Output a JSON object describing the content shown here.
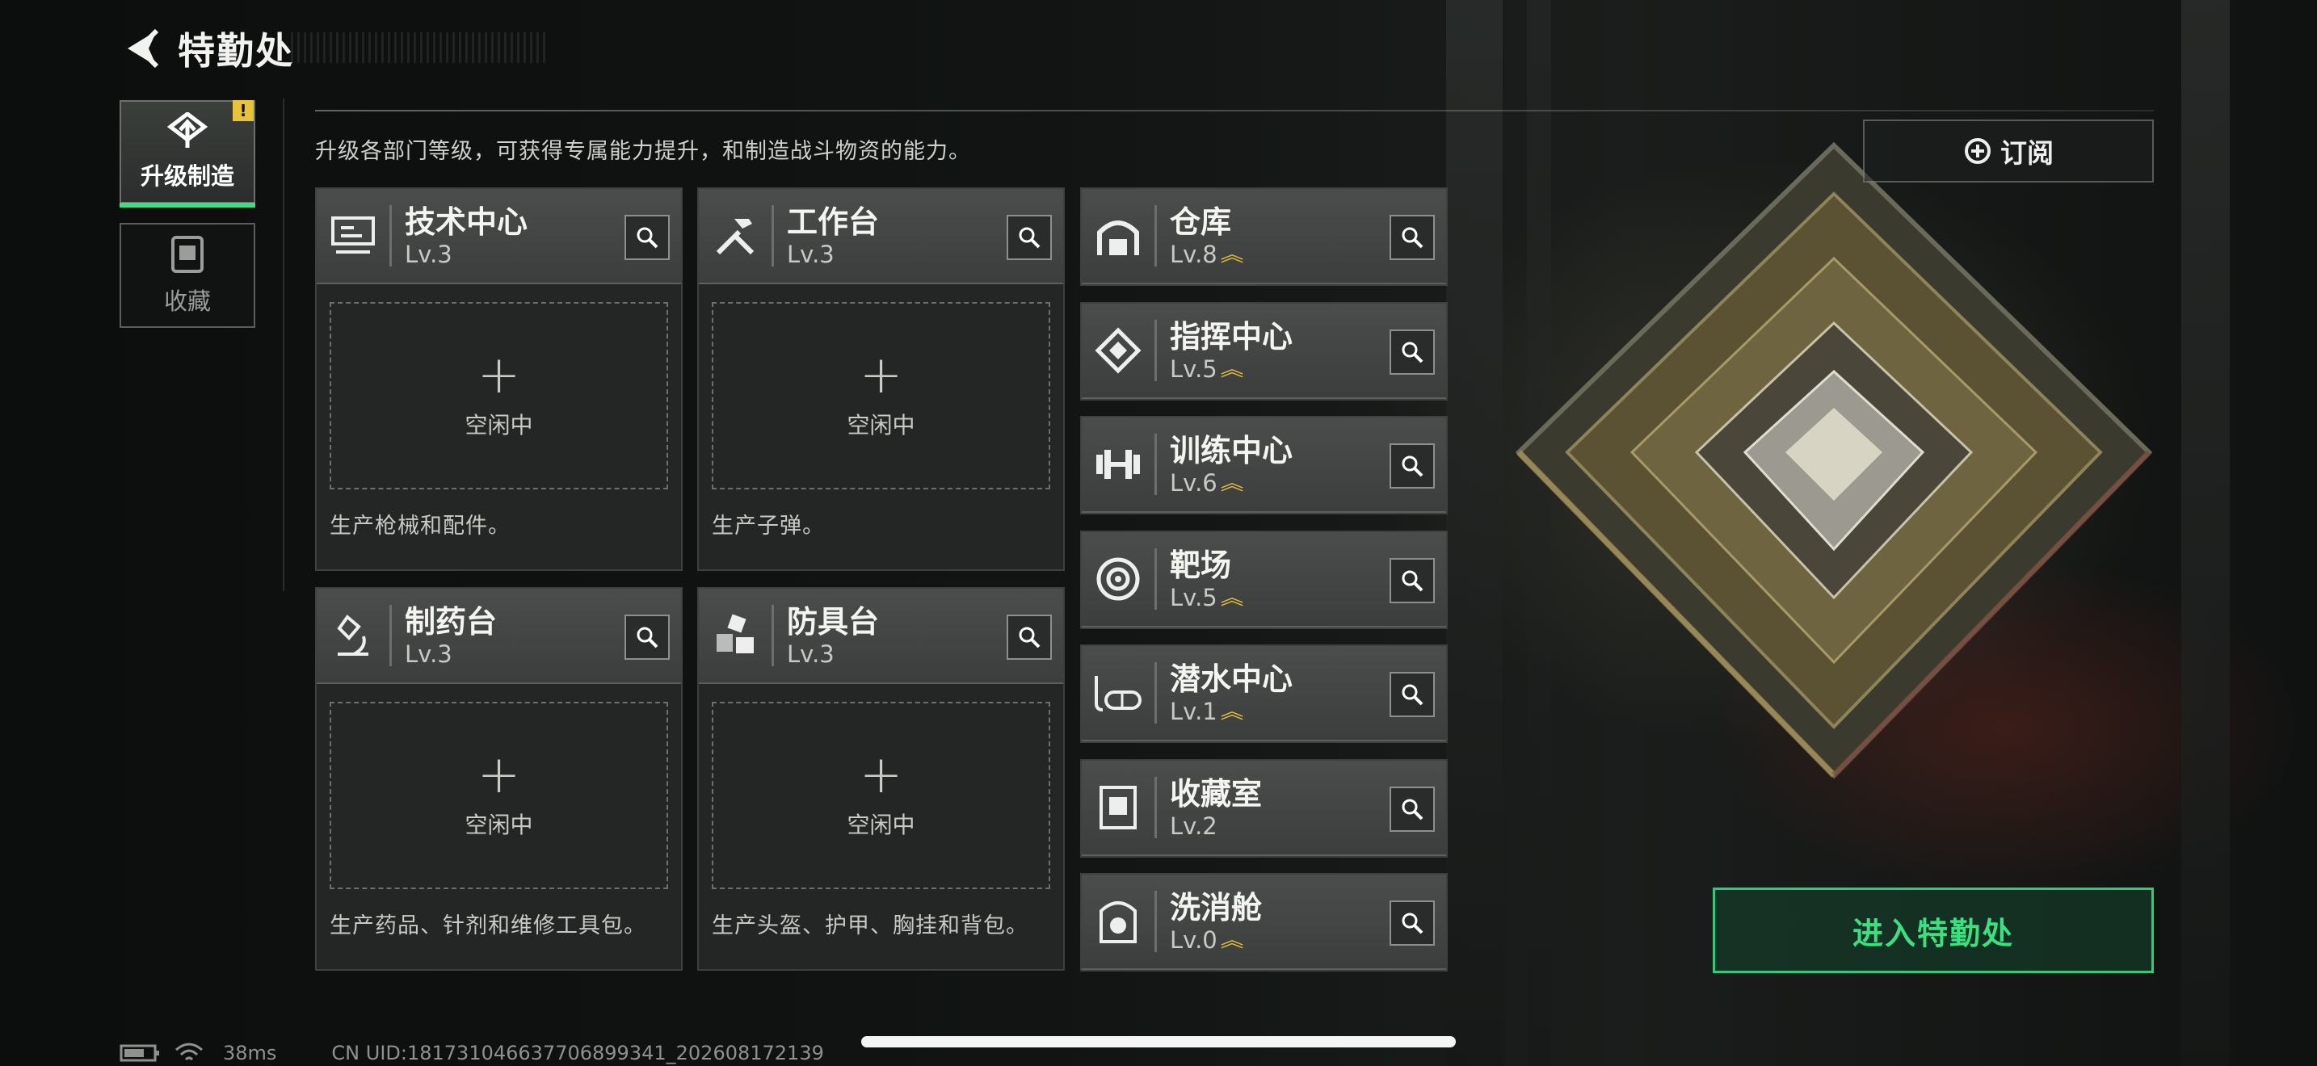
{
  "header": {
    "title": "特勤处"
  },
  "sidebar": {
    "tabs": [
      {
        "label": "升级制造",
        "badge": "!"
      },
      {
        "label": "收藏"
      }
    ]
  },
  "description": "升级各部门等级，可获得专属能力提升，和制造战斗物资的能力。",
  "subscribe": {
    "label": "订阅"
  },
  "idle_label": "空闲中",
  "big_stations": [
    {
      "name": "技术中心",
      "level": "Lv.3",
      "produces": "生产枪械和配件。",
      "icon": "tech-center-icon"
    },
    {
      "name": "工作台",
      "level": "Lv.3",
      "produces": "生产子弹。",
      "icon": "workbench-icon"
    },
    {
      "name": "制药台",
      "level": "Lv.3",
      "produces": "生产药品、针剂和维修工具包。",
      "icon": "pharmacy-icon"
    },
    {
      "name": "防具台",
      "level": "Lv.3",
      "produces": "生产头盔、护甲、胸挂和背包。",
      "icon": "armor-bench-icon"
    }
  ],
  "small_stations": [
    {
      "name": "仓库",
      "level": "Lv.8",
      "upgradable": true,
      "icon": "warehouse-icon"
    },
    {
      "name": "指挥中心",
      "level": "Lv.5",
      "upgradable": true,
      "icon": "command-center-icon"
    },
    {
      "name": "训练中心",
      "level": "Lv.6",
      "upgradable": true,
      "icon": "dumbbell-icon"
    },
    {
      "name": "靶场",
      "level": "Lv.5",
      "upgradable": true,
      "icon": "target-icon"
    },
    {
      "name": "潜水中心",
      "level": "Lv.1",
      "upgradable": true,
      "icon": "diving-mask-icon"
    },
    {
      "name": "收藏室",
      "level": "Lv.2",
      "upgradable": false,
      "icon": "collection-room-icon"
    },
    {
      "name": "洗消舱",
      "level": "Lv.0",
      "upgradable": true,
      "icon": "decon-pod-icon"
    }
  ],
  "enter_button": {
    "label": "进入特勤处"
  },
  "status_bar": {
    "ping": "38ms",
    "uid": "CN UID:181731046637706899341_202608172139"
  },
  "colors": {
    "accent": "#3be081",
    "upgrade": "#e8c23a",
    "panel": "#242625"
  }
}
